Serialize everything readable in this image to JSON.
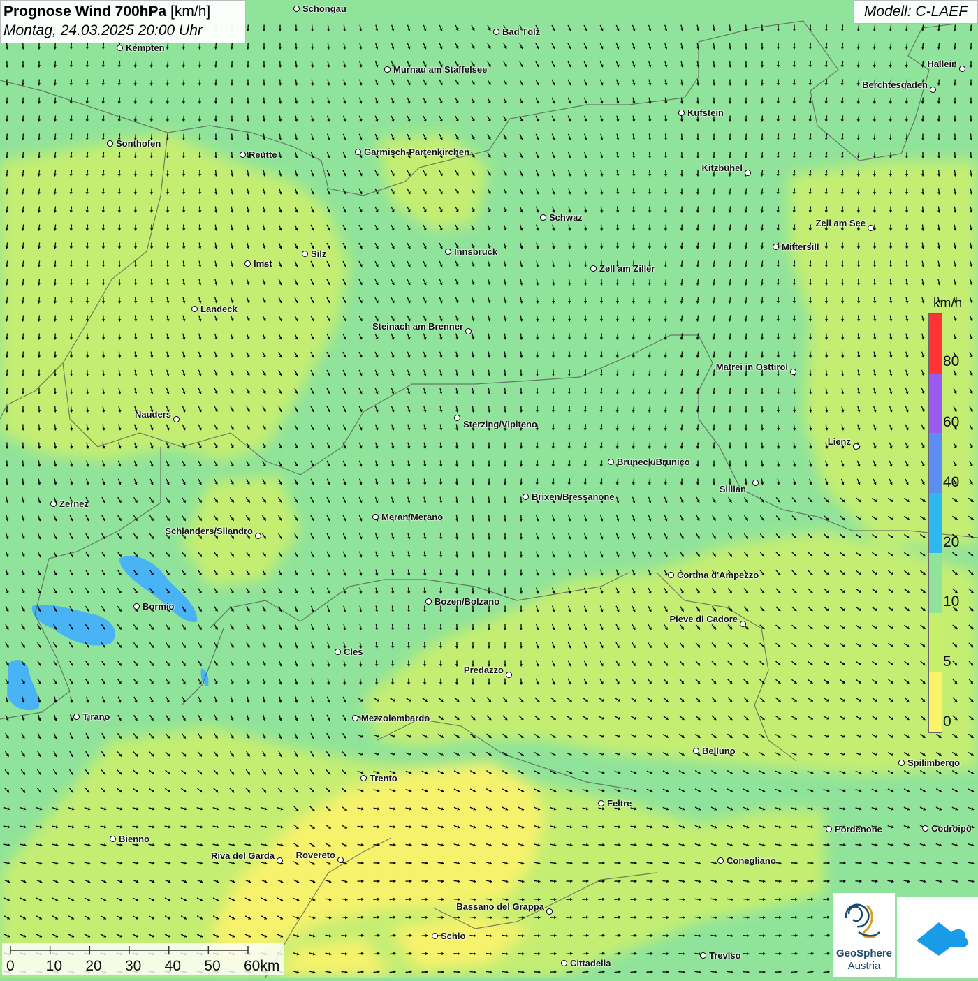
{
  "title": {
    "main": "Prognose Wind 700hPa",
    "unit": "[km/h]",
    "date": "Montag, 24.03.2025 20:00 Uhr"
  },
  "model": "Modell: C-LAEF",
  "legend": {
    "unit": "km/h",
    "labels": [
      "80",
      "60",
      "40",
      "20",
      "10",
      "5",
      "0"
    ],
    "colors": [
      "#ff3333",
      "#9a5cf0",
      "#5b8ef0",
      "#2fb8f0",
      "#8fe39a",
      "#c8ef6a",
      "#fbf36a"
    ]
  },
  "scale": {
    "labels": [
      "0",
      "10",
      "20",
      "30",
      "40",
      "50",
      "60km"
    ]
  },
  "logos": {
    "geosphere_line1": "GeoSphere",
    "geosphere_line2": "Austria"
  },
  "cities": [
    {
      "id": "schongau",
      "name": "Schongau"
    },
    {
      "id": "bad-toelz",
      "name": "Bad Tölz"
    },
    {
      "id": "kempten",
      "name": "Kempten"
    },
    {
      "id": "murnau",
      "name": "Murnau am Staffelsee"
    },
    {
      "id": "hallein",
      "name": "Hallein"
    },
    {
      "id": "berchtesgaden",
      "name": "Berchtesgaden"
    },
    {
      "id": "kufstein",
      "name": "Kufstein"
    },
    {
      "id": "sonthofen",
      "name": "Sonthofen"
    },
    {
      "id": "reutte",
      "name": "Reutte"
    },
    {
      "id": "garmisch",
      "name": "Garmisch-Partenkirchen"
    },
    {
      "id": "kitzbuehel",
      "name": "Kitzbühel"
    },
    {
      "id": "schwaz",
      "name": "Schwaz"
    },
    {
      "id": "zell-am-see",
      "name": "Zell am See"
    },
    {
      "id": "mittersill",
      "name": "Mittersill"
    },
    {
      "id": "silz",
      "name": "Silz"
    },
    {
      "id": "innsbruck",
      "name": "Innsbruck"
    },
    {
      "id": "imst",
      "name": "Imst"
    },
    {
      "id": "zell-am-ziller",
      "name": "Zell am Ziller"
    },
    {
      "id": "landeck",
      "name": "Landeck"
    },
    {
      "id": "steinach",
      "name": "Steinach am Brenner"
    },
    {
      "id": "matrei",
      "name": "Matrei in Osttirol"
    },
    {
      "id": "nauders",
      "name": "Nauders"
    },
    {
      "id": "sterzing",
      "name": "Sterzing/Vipiteno"
    },
    {
      "id": "lienz",
      "name": "Lienz"
    },
    {
      "id": "bruneck",
      "name": "Bruneck/Brunico"
    },
    {
      "id": "sillian",
      "name": "Sillian"
    },
    {
      "id": "brixen",
      "name": "Brixen/Bressanone"
    },
    {
      "id": "zernez",
      "name": "Zernez"
    },
    {
      "id": "meran",
      "name": "Meran/Merano"
    },
    {
      "id": "schlanders",
      "name": "Schlanders/Silandro"
    },
    {
      "id": "cortina",
      "name": "Cortina d'Ampezzo"
    },
    {
      "id": "bozen",
      "name": "Bozen/Bolzano"
    },
    {
      "id": "bormio",
      "name": "Bormio"
    },
    {
      "id": "pieve",
      "name": "Pieve di Cadore"
    },
    {
      "id": "cles",
      "name": "Cles"
    },
    {
      "id": "predazzo",
      "name": "Predazzo"
    },
    {
      "id": "tirano",
      "name": "Tirano"
    },
    {
      "id": "mezzolombardo",
      "name": "Mezzolombardo"
    },
    {
      "id": "belluno",
      "name": "Belluno"
    },
    {
      "id": "spilimbergo",
      "name": "Spilimbergo"
    },
    {
      "id": "trento",
      "name": "Trento"
    },
    {
      "id": "feltre",
      "name": "Feltre"
    },
    {
      "id": "pordenone",
      "name": "Pordenone"
    },
    {
      "id": "codroipo",
      "name": "Codroipo"
    },
    {
      "id": "bienno",
      "name": "Bienno"
    },
    {
      "id": "riva",
      "name": "Riva del Garda"
    },
    {
      "id": "rovereto",
      "name": "Rovereto"
    },
    {
      "id": "conegliano",
      "name": "Conegliano"
    },
    {
      "id": "bassano",
      "name": "Bassano del Grappa"
    },
    {
      "id": "schio",
      "name": "Schio"
    },
    {
      "id": "treviso",
      "name": "Treviso"
    },
    {
      "id": "cittadella",
      "name": "Cittadella"
    }
  ]
}
